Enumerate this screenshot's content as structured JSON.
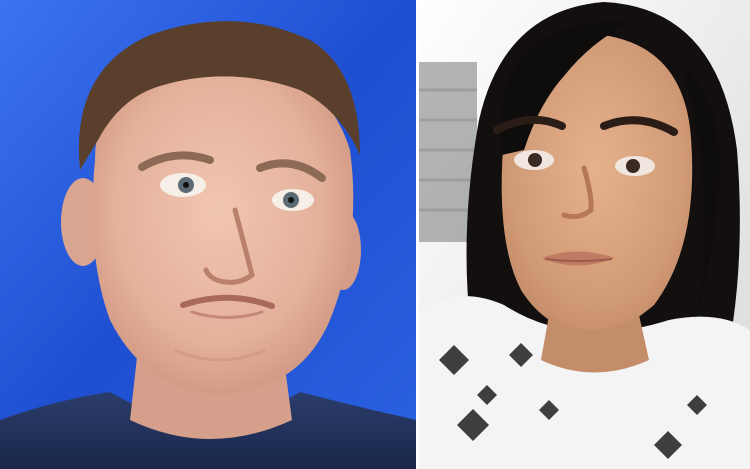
{
  "collage": {
    "left_photo": {
      "subject": "man-portrait",
      "background_color": "#1f4fd1",
      "skin_color": "#e7b9a3",
      "hair_color": "#5a3f2c",
      "shirt_color": "#23335c"
    },
    "right_photo": {
      "subject": "woman-selfie",
      "background_color": "#f2f2f2",
      "skin_color": "#d6a27f",
      "hair_color": "#120f0e",
      "shirt_color": "#f4f4f4"
    },
    "divider_color": "#ffffff"
  }
}
